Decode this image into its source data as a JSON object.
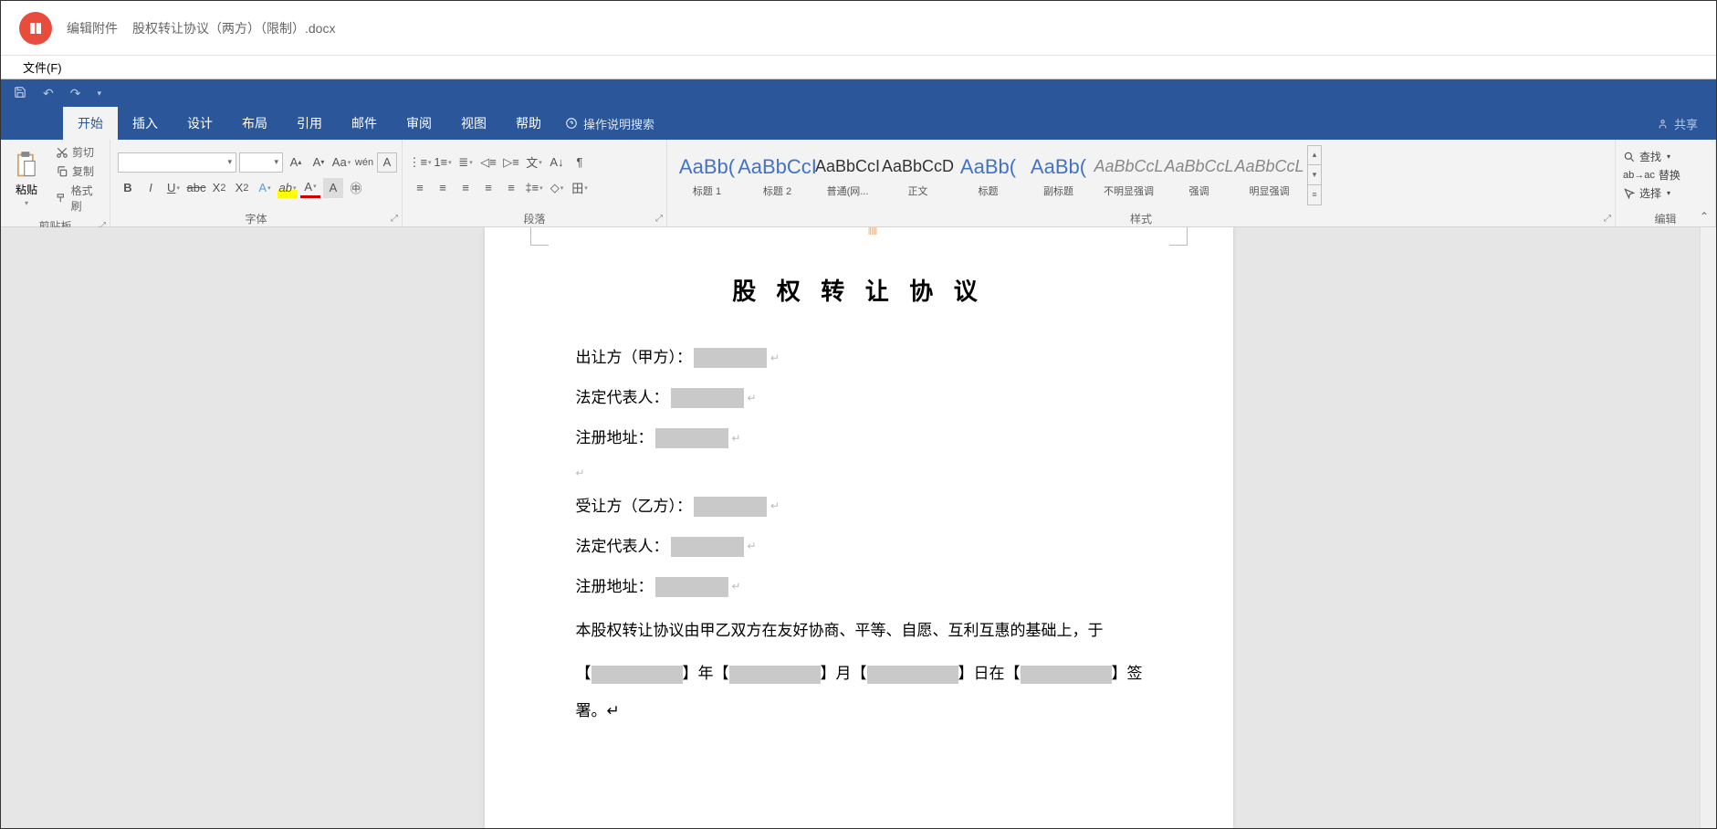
{
  "titlebar": {
    "prefix": "编辑附件",
    "filename": "股权转让协议（两方）（限制）.docx"
  },
  "filemenu": {
    "file": "文件(F)"
  },
  "ribbonTabs": {
    "start": "开始",
    "insert": "插入",
    "design": "设计",
    "layout": "布局",
    "references": "引用",
    "mailings": "邮件",
    "review": "审阅",
    "view": "视图",
    "help": "帮助",
    "tellMe": "操作说明搜索",
    "share": "共享"
  },
  "clipboard": {
    "paste": "粘贴",
    "cut": "剪切",
    "copy": "复制",
    "formatPainter": "格式刷",
    "groupLabel": "剪贴板"
  },
  "font": {
    "groupLabel": "字体",
    "fontName": "",
    "fontSize": ""
  },
  "paragraph": {
    "groupLabel": "段落"
  },
  "styles": {
    "groupLabel": "样式",
    "items": [
      {
        "preview": "AaBb(",
        "name": "标题 1",
        "cls": "h1"
      },
      {
        "preview": "AaBbCcI",
        "name": "标题 2",
        "cls": "h1"
      },
      {
        "preview": "AaBbCcI",
        "name": "普通(网...",
        "cls": "normal"
      },
      {
        "preview": "AaBbCcD",
        "name": "正文",
        "cls": "normal"
      },
      {
        "preview": "AaBb(",
        "name": "标题",
        "cls": "h1"
      },
      {
        "preview": "AaBb(",
        "name": "副标题",
        "cls": "h1"
      },
      {
        "preview": "AaBbCcL",
        "name": "不明显强调",
        "cls": "emphasis"
      },
      {
        "preview": "AaBbCcL",
        "name": "强调",
        "cls": "emphasis"
      },
      {
        "preview": "AaBbCcL",
        "name": "明显强调",
        "cls": "emphasis"
      }
    ]
  },
  "editing": {
    "find": "查找",
    "replace": "替换",
    "select": "选择",
    "groupLabel": "编辑"
  },
  "document": {
    "title": "股 权 转 让 协 议",
    "partyA": "出让方（甲方）：",
    "legalRep": "法定代表人：",
    "regAddr": "注册地址：",
    "partyB": "受让方（乙方）：",
    "body1": "本股权转让协议由甲乙双方在友好协商、平等、自愿、互利互惠的基础上，于",
    "year": "】年【",
    "month": "】月【",
    "day": "】日在【",
    "sign": "】签署。"
  }
}
